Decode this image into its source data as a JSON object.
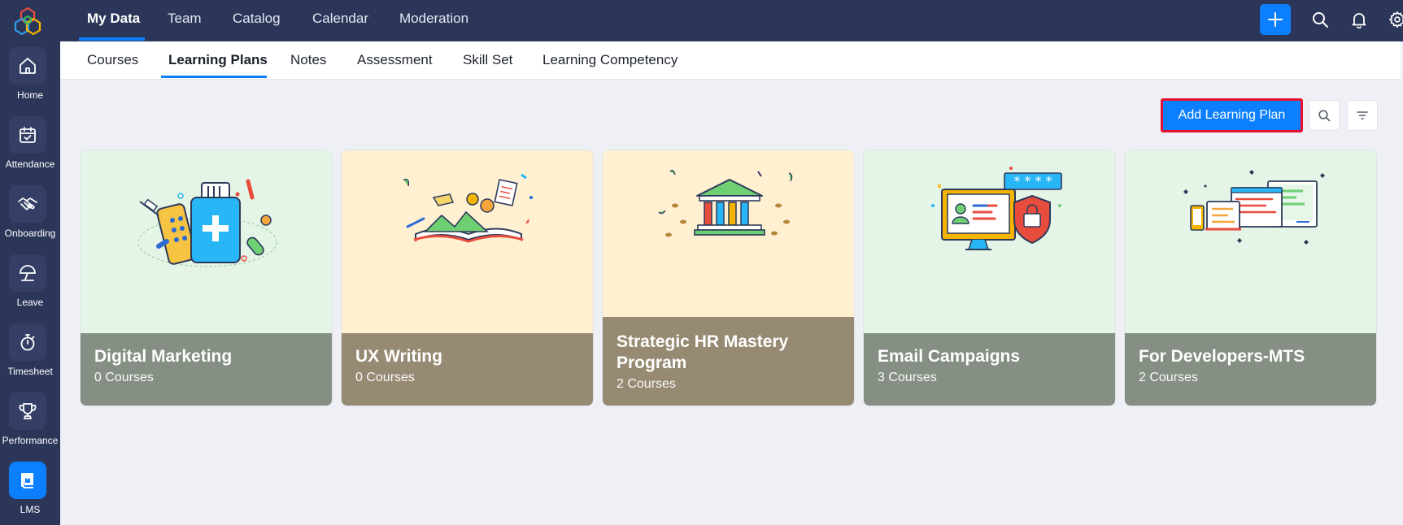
{
  "sidebar": {
    "items": [
      {
        "label": "Home",
        "icon": "home-icon"
      },
      {
        "label": "Attendance",
        "icon": "calendar-check-icon"
      },
      {
        "label": "Onboarding",
        "icon": "handshake-icon"
      },
      {
        "label": "Leave",
        "icon": "umbrella-icon"
      },
      {
        "label": "Timesheet",
        "icon": "stopwatch-icon"
      },
      {
        "label": "Performance",
        "icon": "trophy-icon"
      },
      {
        "label": "LMS",
        "icon": "lms-book-icon"
      }
    ]
  },
  "topnav": {
    "items": [
      "My Data",
      "Team",
      "Catalog",
      "Calendar",
      "Moderation"
    ],
    "active": "My Data"
  },
  "subnav": {
    "items": [
      "Courses",
      "Learning Plans",
      "Notes",
      "Assessment",
      "Skill Set",
      "Learning Competency"
    ],
    "active": "Learning Plans"
  },
  "toolbar": {
    "add_label": "Add Learning Plan"
  },
  "cards": [
    {
      "title": "Digital Marketing",
      "subtitle": "0 Courses",
      "illustration": "medical-kit-illustration"
    },
    {
      "title": "UX Writing",
      "subtitle": "0 Courses",
      "illustration": "open-book-illustration"
    },
    {
      "title": "Strategic HR Mastery Program",
      "subtitle": "2 Courses",
      "illustration": "bank-building-illustration"
    },
    {
      "title": "Email Campaigns",
      "subtitle": "3 Courses",
      "illustration": "secure-monitor-illustration"
    },
    {
      "title": "For Developers-MTS",
      "subtitle": "2 Courses",
      "illustration": "multi-device-illustration"
    }
  ],
  "colors": {
    "sidebar_bg": "#2c3659",
    "accent": "#0c7fff",
    "highlight_border": "#e8102e",
    "card_green_bg": "#e4f4e6",
    "card_yellow_bg": "#fff0d1",
    "card_green_foot": "#858f84",
    "card_brown_foot": "#968a73"
  }
}
